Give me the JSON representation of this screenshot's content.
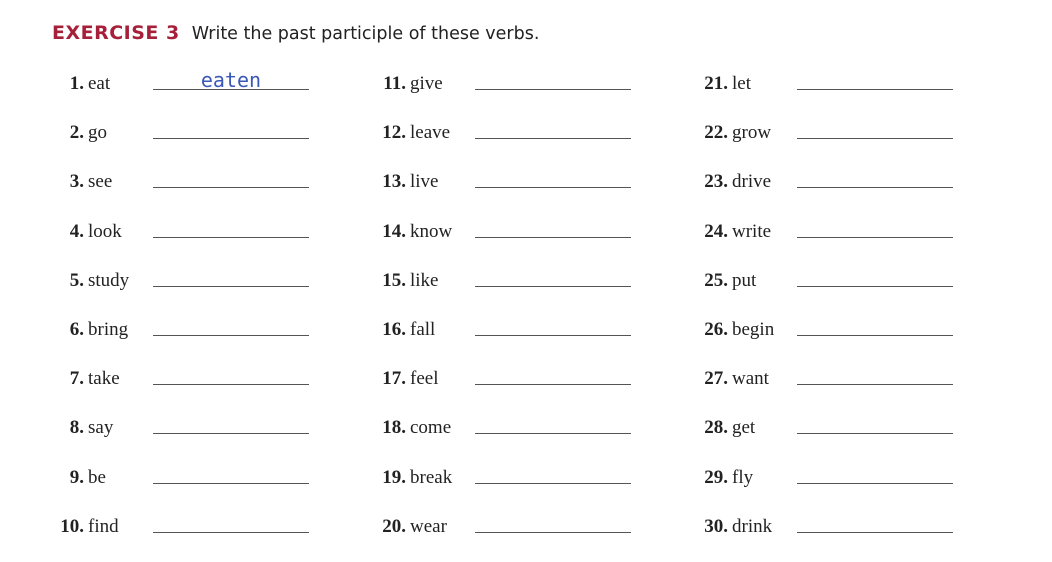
{
  "header": {
    "exercise_label": "EXERCISE 3",
    "instruction": "Write the past participle of these verbs."
  },
  "items": [
    {
      "num": "1.",
      "verb": "eat",
      "answer": "eaten"
    },
    {
      "num": "2.",
      "verb": "go",
      "answer": ""
    },
    {
      "num": "3.",
      "verb": "see",
      "answer": ""
    },
    {
      "num": "4.",
      "verb": "look",
      "answer": ""
    },
    {
      "num": "5.",
      "verb": "study",
      "answer": ""
    },
    {
      "num": "6.",
      "verb": "bring",
      "answer": ""
    },
    {
      "num": "7.",
      "verb": "take",
      "answer": ""
    },
    {
      "num": "8.",
      "verb": "say",
      "answer": ""
    },
    {
      "num": "9.",
      "verb": "be",
      "answer": ""
    },
    {
      "num": "10.",
      "verb": "find",
      "answer": ""
    },
    {
      "num": "11.",
      "verb": "give",
      "answer": ""
    },
    {
      "num": "12.",
      "verb": "leave",
      "answer": ""
    },
    {
      "num": "13.",
      "verb": "live",
      "answer": ""
    },
    {
      "num": "14.",
      "verb": "know",
      "answer": ""
    },
    {
      "num": "15.",
      "verb": "like",
      "answer": ""
    },
    {
      "num": "16.",
      "verb": "fall",
      "answer": ""
    },
    {
      "num": "17.",
      "verb": "feel",
      "answer": ""
    },
    {
      "num": "18.",
      "verb": "come",
      "answer": ""
    },
    {
      "num": "19.",
      "verb": "break",
      "answer": ""
    },
    {
      "num": "20.",
      "verb": "wear",
      "answer": ""
    },
    {
      "num": "21.",
      "verb": "let",
      "answer": ""
    },
    {
      "num": "22.",
      "verb": "grow",
      "answer": ""
    },
    {
      "num": "23.",
      "verb": "drive",
      "answer": ""
    },
    {
      "num": "24.",
      "verb": "write",
      "answer": ""
    },
    {
      "num": "25.",
      "verb": "put",
      "answer": ""
    },
    {
      "num": "26.",
      "verb": "begin",
      "answer": ""
    },
    {
      "num": "27.",
      "verb": "want",
      "answer": ""
    },
    {
      "num": "28.",
      "verb": "get",
      "answer": ""
    },
    {
      "num": "29.",
      "verb": "fly",
      "answer": ""
    },
    {
      "num": "30.",
      "verb": "drink",
      "answer": ""
    }
  ],
  "colors": {
    "exercise_label": "#a6203a",
    "handwriting": "#3a58b5"
  }
}
